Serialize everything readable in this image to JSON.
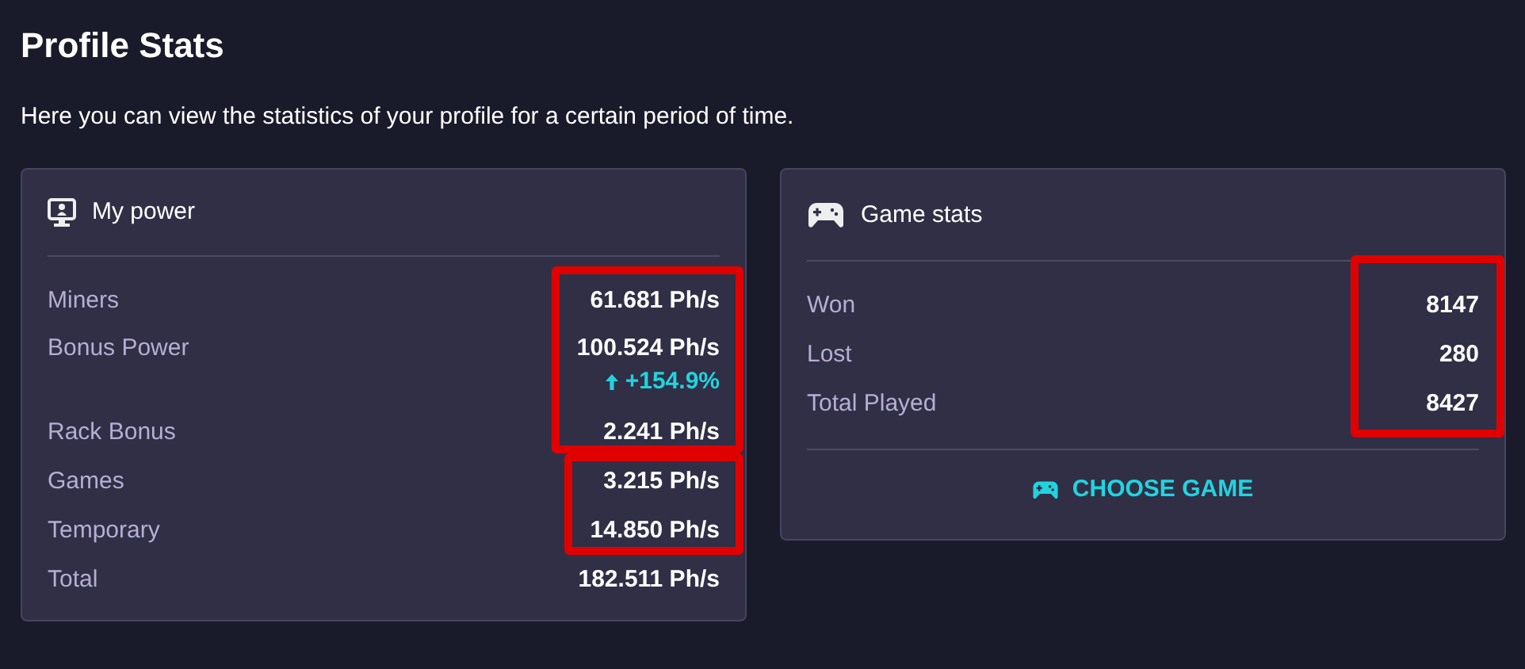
{
  "page": {
    "title": "Profile Stats",
    "description": "Here you can view the statistics of your profile for a certain period of time."
  },
  "cards": [
    {
      "kind": "power",
      "title": "My power",
      "groups": [
        {
          "highlighted": true,
          "rows": [
            {
              "label": "Miners",
              "value": "61.681 Ph/s"
            },
            {
              "label": "Bonus Power",
              "value": "100.524 Ph/s",
              "change": "+154.9%"
            },
            {
              "label": "Rack Bonus",
              "value": "2.241 Ph/s"
            }
          ]
        },
        {
          "highlighted": true,
          "rows": [
            {
              "label": "Games",
              "value": "3.215 Ph/s"
            },
            {
              "label": "Temporary",
              "value": "14.850 Ph/s"
            }
          ]
        },
        {
          "highlighted": false,
          "rows": [
            {
              "label": "Total",
              "value": "182.511 Ph/s"
            }
          ]
        }
      ]
    },
    {
      "kind": "games",
      "title": "Game stats",
      "groups": [
        {
          "highlighted": true,
          "rows": [
            {
              "label": "Won",
              "value": "8147"
            },
            {
              "label": "Lost",
              "value": "280"
            },
            {
              "label": "Total Played",
              "value": "8427"
            }
          ]
        }
      ],
      "action": "CHOOSE GAME"
    }
  ]
}
